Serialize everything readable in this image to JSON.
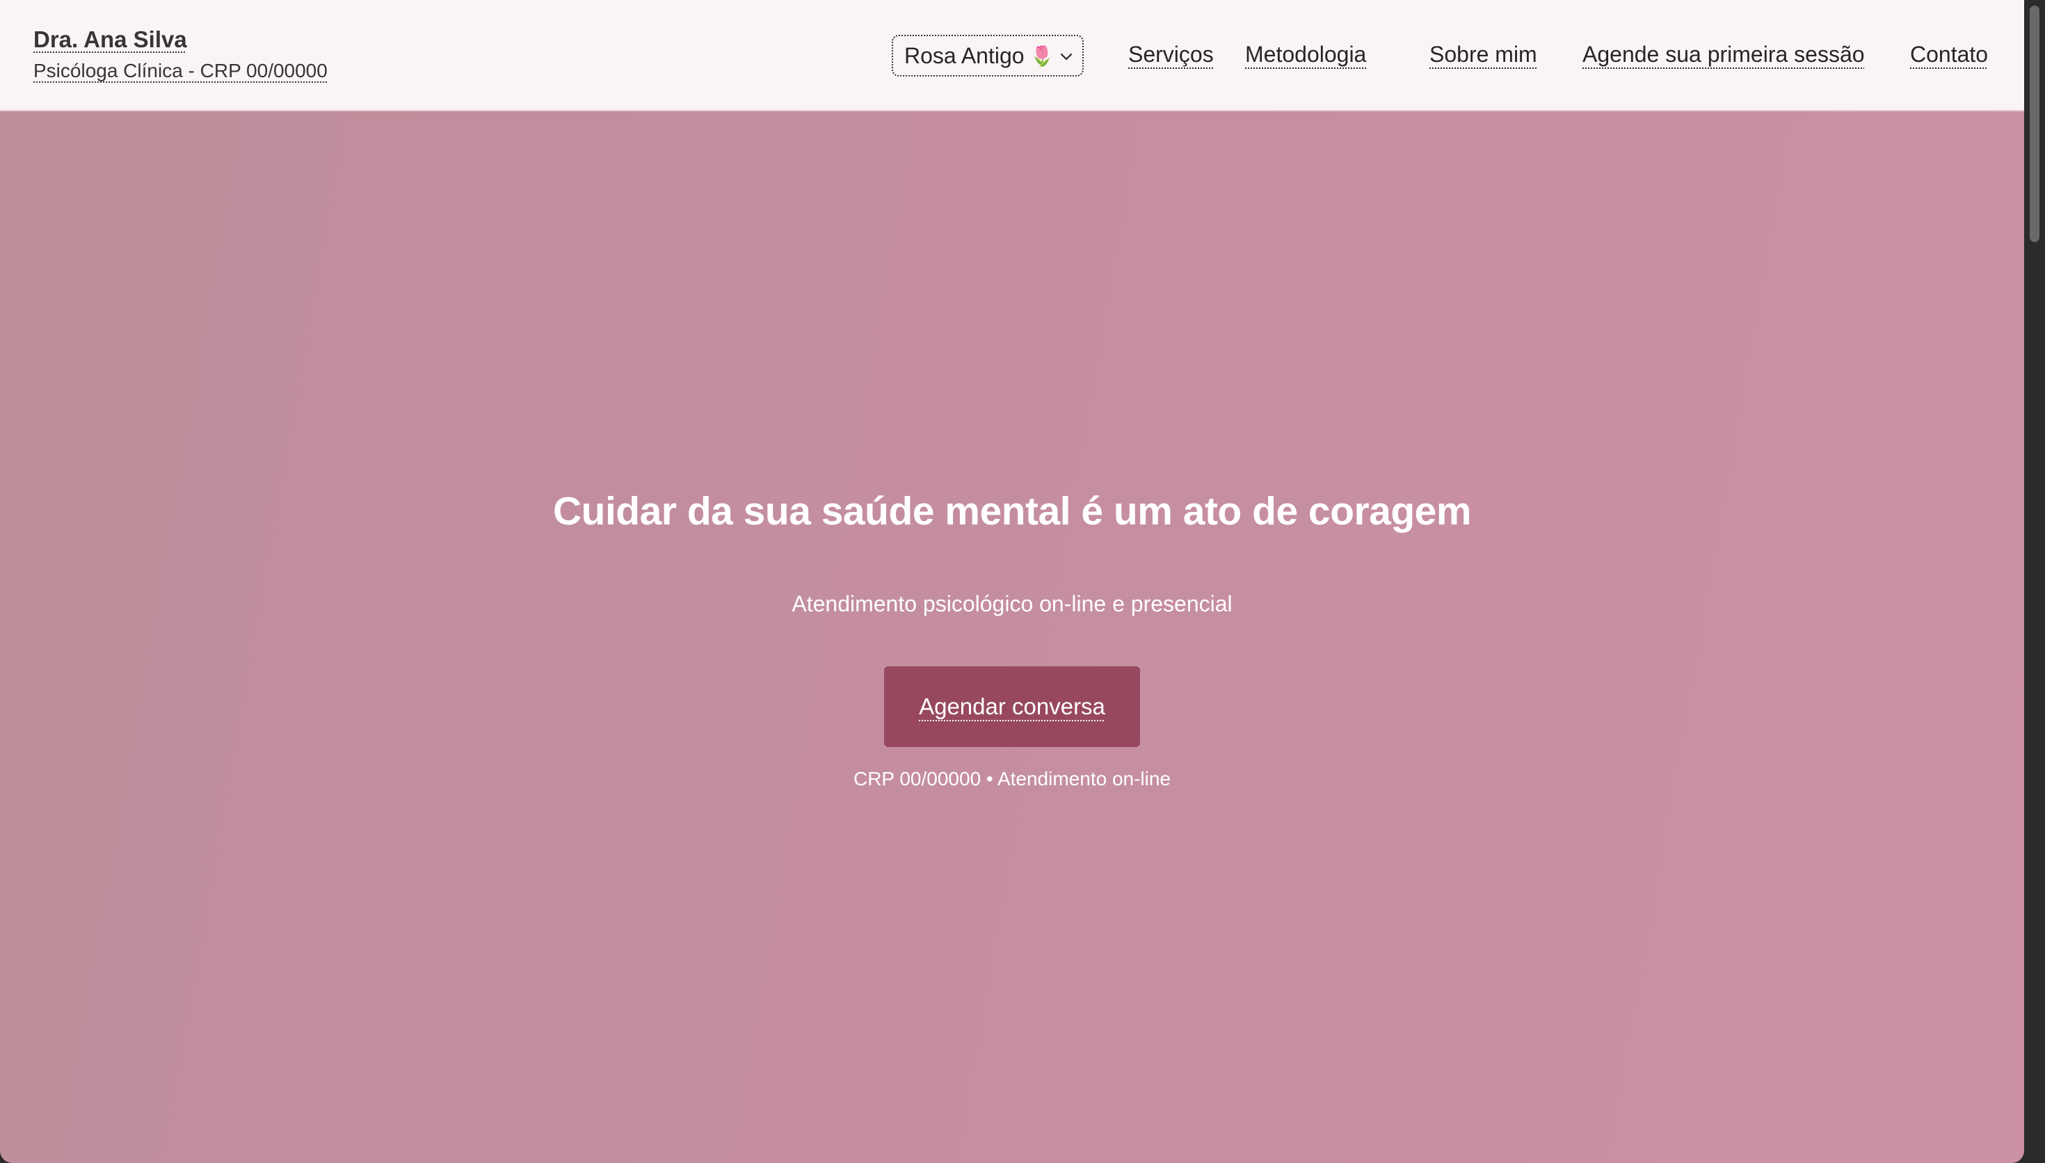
{
  "header": {
    "brand_name": "Dra. Ana Silva",
    "brand_subtitle": "Psicóloga Clínica - CRP 00/00000",
    "theme_select": {
      "selected": "Rosa Antigo",
      "icon": "tulip-icon"
    },
    "nav": [
      {
        "label": "Serviços"
      },
      {
        "label": "Metodologia"
      },
      {
        "label": "Sobre mim"
      },
      {
        "label": "Agende sua primeira sessão"
      },
      {
        "label": "Contato"
      }
    ]
  },
  "hero": {
    "title": "Cuidar da sua saúde mental é um ato de coragem",
    "subtitle": "Atendimento psicológico on-line e presencial",
    "cta_label": "Agendar conversa",
    "note": "CRP 00/00000 • Atendimento on-line"
  },
  "colors": {
    "header_bg": "#faf4f5",
    "hero_bg": "#c48ea0",
    "cta_bg": "#97485f",
    "text_dark": "#2a2427",
    "text_light": "#ffffff"
  }
}
